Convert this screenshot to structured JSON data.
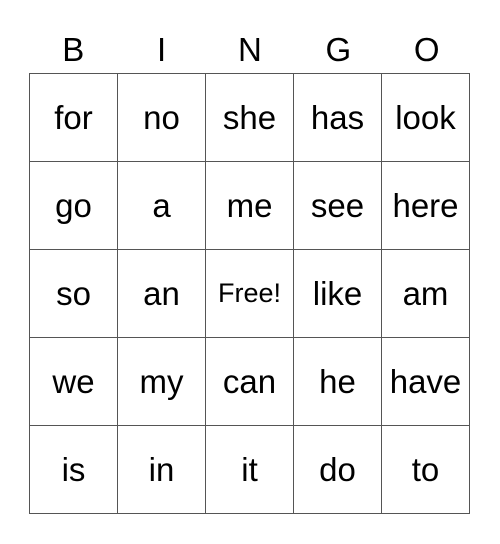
{
  "header": [
    "B",
    "I",
    "N",
    "G",
    "O"
  ],
  "rows": [
    [
      "for",
      "no",
      "she",
      "has",
      "look"
    ],
    [
      "go",
      "a",
      "me",
      "see",
      "here"
    ],
    [
      "so",
      "an",
      "Free!",
      "like",
      "am"
    ],
    [
      "we",
      "my",
      "can",
      "he",
      "have"
    ],
    [
      "is",
      "in",
      "it",
      "do",
      "to"
    ]
  ]
}
